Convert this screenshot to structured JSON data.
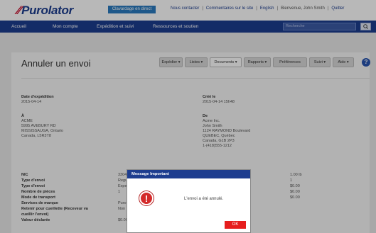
{
  "header": {
    "logo_text": "Purolator",
    "chat_button": "Clavardage en direct",
    "links": [
      "Nous contacter",
      "Commentaires sur le site",
      "English"
    ],
    "greeting": "Bienvenue, John Smith",
    "logout": "Quitter"
  },
  "nav": {
    "items": [
      "Accueil",
      "Mon compte",
      "Expédition et suivi",
      "Ressources et soutien"
    ],
    "search_placeholder": "Recherche"
  },
  "page": {
    "title": "Annuler un envoi",
    "tabs": [
      "Expédier ▾",
      "Listes ▾",
      "Documents ▾",
      "Rapports ▾",
      "Préférences",
      "Suivi ▾",
      "Aide ▾"
    ],
    "active_tab": "Documents ▾"
  },
  "details": {
    "ship_date_label": "Date d'expédition",
    "ship_date": "2015-04-14",
    "created_label": "Créé le",
    "created": "2015-04-14 15h48",
    "to_label": "À",
    "to_lines": [
      "ACME",
      "5995 AVEBURY RD",
      "MISSISSAUGA, Ontario",
      "Canada, L5R3T8"
    ],
    "from_label": "De",
    "from_lines": [
      "Acme Inc.",
      "John Smith",
      "1124 RAYMOND Boulevard",
      "QUEBEC, Québec",
      "Canada, G1B 2P3",
      "1-(418)555-1212"
    ]
  },
  "table": {
    "labels": [
      "NIC",
      "Type d'envoi",
      "Type d'envoi",
      "Nombre de pièces",
      "Mode de transport",
      "Services de marque",
      "Retenir pour cueillette (Receveur va",
      "cueillir l'envoi)",
      "Valeur déclarée"
    ],
    "values_left": [
      "3304",
      "Regu",
      "Expe",
      "1",
      "",
      "Puro",
      "Non",
      "",
      "$0.00"
    ],
    "values_right": [
      "1.00 lb",
      "1",
      "$0.00",
      "$0.00",
      "$0.00"
    ]
  },
  "dialog": {
    "title": "Message Important",
    "icon": "!",
    "message": "L'envoi a été annulé.",
    "ok": "OK"
  },
  "colors": {
    "brand_blue": "#1d3d8f",
    "brand_red": "#c8102e",
    "ok_red": "#e61e1e"
  }
}
